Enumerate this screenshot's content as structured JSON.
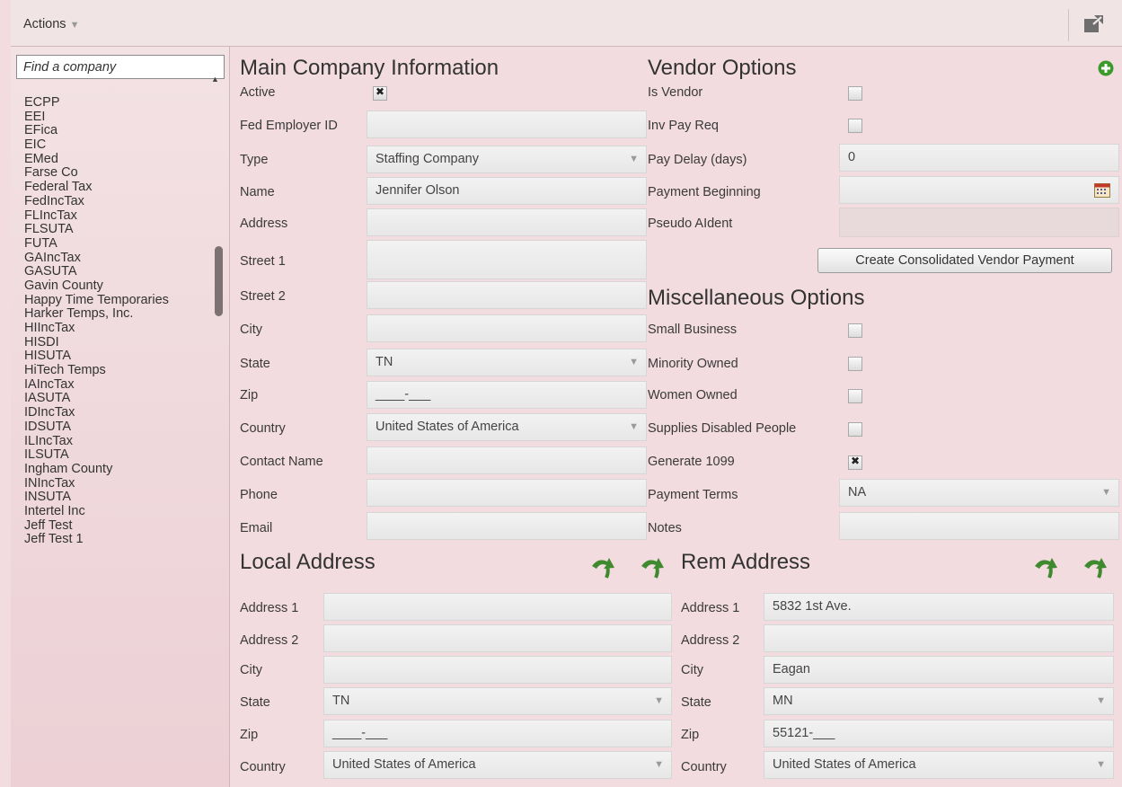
{
  "toolbar": {
    "actions_label": "Actions",
    "popout_icon": "popout-icon"
  },
  "search": {
    "placeholder": "Find a company"
  },
  "companies": [
    "ECPP",
    "EEI",
    "EFica",
    "EIC",
    "EMed",
    "Farse Co",
    "Federal Tax",
    "FedIncTax",
    "FLIncTax",
    "FLSUTA",
    "FUTA",
    "GAIncTax",
    "GASUTA",
    "Gavin County",
    "Happy Time Temporaries",
    "Harker Temps, Inc.",
    "HIIncTax",
    "HISDI",
    "HISUTA",
    "HiTech Temps",
    "IAIncTax",
    "IASUTA",
    "IDIncTax",
    "IDSUTA",
    "ILIncTax",
    "ILSUTA",
    "Ingham County",
    "INIncTax",
    "INSUTA",
    "Intertel Inc",
    "Jeff Test",
    "Jeff Test 1"
  ],
  "main": {
    "title": "Main Company Information",
    "active_label": "Active",
    "active_checked": true,
    "fein_label": "Fed Employer ID",
    "fein_value": "",
    "type_label": "Type",
    "type_value": "Staffing Company",
    "name_label": "Name",
    "name_value": "Jennifer Olson",
    "address_label": "Address",
    "address_value": "",
    "street1_label": "Street 1",
    "street1_value": "",
    "street2_label": "Street 2",
    "street2_value": "",
    "city_label": "City",
    "city_value": "",
    "state_label": "State",
    "state_value": "TN",
    "zip_label": "Zip",
    "zip_value": "____-___",
    "country_label": "Country",
    "country_value": "United States of America",
    "contact_label": "Contact Name",
    "contact_value": "",
    "phone_label": "Phone",
    "phone_value": "",
    "email_label": "Email",
    "email_value": ""
  },
  "vendor": {
    "title": "Vendor Options",
    "is_vendor_label": "Is Vendor",
    "is_vendor_checked": false,
    "inv_pay_label": "Inv Pay Req",
    "inv_pay_checked": false,
    "pay_delay_label": "Pay Delay (days)",
    "pay_delay_value": "0",
    "payment_beginning_label": "Payment Beginning",
    "payment_beginning_value": "",
    "pseudo_label": "Pseudo AIdent",
    "pseudo_value": "",
    "consolidate_button": "Create Consolidated Vendor Payment"
  },
  "misc": {
    "title": "Miscellaneous Options",
    "small_business_label": "Small Business",
    "small_business_checked": false,
    "minority_label": "Minority Owned",
    "minority_checked": false,
    "women_label": "Women Owned",
    "women_checked": false,
    "disabled_label": "Supplies Disabled People",
    "disabled_checked": false,
    "gen1099_label": "Generate 1099",
    "gen1099_checked": true,
    "payment_terms_label": "Payment Terms",
    "payment_terms_value": "NA",
    "notes_label": "Notes",
    "notes_value": ""
  },
  "local": {
    "title": "Local Address",
    "address1_label": "Address 1",
    "address1_value": "",
    "address2_label": "Address 2",
    "address2_value": "",
    "city_label": "City",
    "city_value": "",
    "state_label": "State",
    "state_value": "TN",
    "zip_label": "Zip",
    "zip_value": "____-___",
    "country_label": "Country",
    "country_value": "United States of America"
  },
  "rem": {
    "title": "Rem Address",
    "address1_label": "Address 1",
    "address1_value": "5832 1st Ave.",
    "address2_label": "Address 2",
    "address2_value": "",
    "city_label": "City",
    "city_value": "Eagan",
    "state_label": "State",
    "state_value": "MN",
    "zip_label": "Zip",
    "zip_value": "55121-___",
    "country_label": "Country",
    "country_value": "United States of America"
  },
  "colors": {
    "background": "#f2dcdf",
    "accent_green": "#3f8a2f"
  }
}
